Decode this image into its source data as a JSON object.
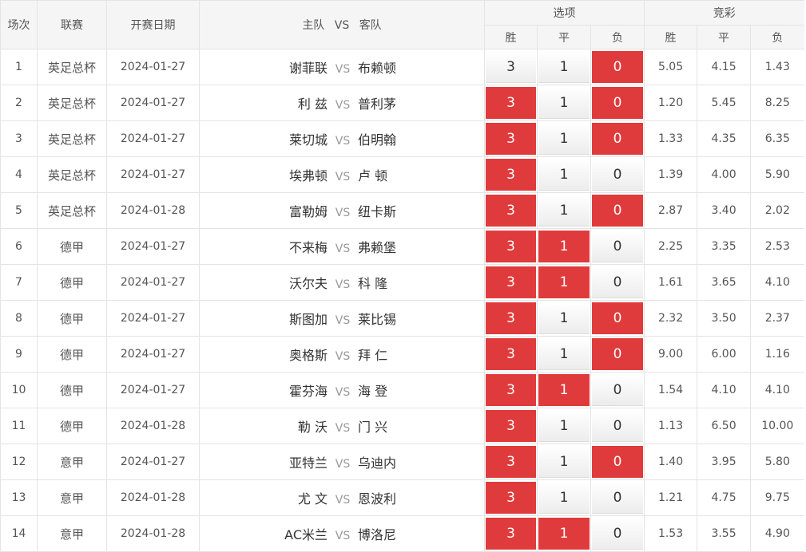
{
  "header": {
    "col_no": "场次",
    "col_league": "联赛",
    "col_date": "开赛日期",
    "col_home": "主队",
    "col_vs": "VS",
    "col_away": "客队",
    "group_options": "选项",
    "group_odds": "竞彩",
    "sub_win": "胜",
    "sub_draw": "平",
    "sub_lose": "负"
  },
  "colors": {
    "selected": "#e03b3c",
    "header_bg": "#f5f5f5",
    "border": "#e4e4e4"
  },
  "vs_text": "VS",
  "options": {
    "win": "3",
    "draw": "1",
    "lose": "0"
  },
  "rows": [
    {
      "no": "1",
      "league": "英足总杯",
      "date": "2024-01-27",
      "home": "谢菲联",
      "away": "布赖顿",
      "sel": [
        false,
        false,
        true
      ],
      "odds": [
        "5.05",
        "4.15",
        "1.43"
      ]
    },
    {
      "no": "2",
      "league": "英足总杯",
      "date": "2024-01-27",
      "home": "利 兹",
      "away": "普利茅",
      "sel": [
        true,
        false,
        true
      ],
      "odds": [
        "1.20",
        "5.45",
        "8.25"
      ]
    },
    {
      "no": "3",
      "league": "英足总杯",
      "date": "2024-01-27",
      "home": "莱切城",
      "away": "伯明翰",
      "sel": [
        true,
        false,
        true
      ],
      "odds": [
        "1.33",
        "4.35",
        "6.35"
      ]
    },
    {
      "no": "4",
      "league": "英足总杯",
      "date": "2024-01-27",
      "home": "埃弗顿",
      "away": "卢 顿",
      "sel": [
        true,
        false,
        false
      ],
      "odds": [
        "1.39",
        "4.00",
        "5.90"
      ]
    },
    {
      "no": "5",
      "league": "英足总杯",
      "date": "2024-01-28",
      "home": "富勒姆",
      "away": "纽卡斯",
      "sel": [
        true,
        false,
        true
      ],
      "odds": [
        "2.87",
        "3.40",
        "2.02"
      ]
    },
    {
      "no": "6",
      "league": "德甲",
      "date": "2024-01-27",
      "home": "不来梅",
      "away": "弗赖堡",
      "sel": [
        true,
        true,
        false
      ],
      "odds": [
        "2.25",
        "3.35",
        "2.53"
      ]
    },
    {
      "no": "7",
      "league": "德甲",
      "date": "2024-01-27",
      "home": "沃尔夫",
      "away": "科 隆",
      "sel": [
        true,
        true,
        false
      ],
      "odds": [
        "1.61",
        "3.65",
        "4.10"
      ]
    },
    {
      "no": "8",
      "league": "德甲",
      "date": "2024-01-27",
      "home": "斯图加",
      "away": "莱比锡",
      "sel": [
        true,
        false,
        true
      ],
      "odds": [
        "2.32",
        "3.50",
        "2.37"
      ]
    },
    {
      "no": "9",
      "league": "德甲",
      "date": "2024-01-27",
      "home": "奥格斯",
      "away": "拜 仁",
      "sel": [
        true,
        false,
        true
      ],
      "odds": [
        "9.00",
        "6.00",
        "1.16"
      ]
    },
    {
      "no": "10",
      "league": "德甲",
      "date": "2024-01-27",
      "home": "霍芬海",
      "away": "海 登",
      "sel": [
        true,
        true,
        false
      ],
      "odds": [
        "1.54",
        "4.10",
        "4.10"
      ]
    },
    {
      "no": "11",
      "league": "德甲",
      "date": "2024-01-28",
      "home": "勒 沃",
      "away": "门 兴",
      "sel": [
        true,
        false,
        false
      ],
      "odds": [
        "1.13",
        "6.50",
        "10.00"
      ]
    },
    {
      "no": "12",
      "league": "意甲",
      "date": "2024-01-27",
      "home": "亚特兰",
      "away": "乌迪内",
      "sel": [
        true,
        false,
        true
      ],
      "odds": [
        "1.40",
        "3.95",
        "5.80"
      ]
    },
    {
      "no": "13",
      "league": "意甲",
      "date": "2024-01-28",
      "home": "尤 文",
      "away": "恩波利",
      "sel": [
        true,
        false,
        false
      ],
      "odds": [
        "1.21",
        "4.75",
        "9.75"
      ]
    },
    {
      "no": "14",
      "league": "意甲",
      "date": "2024-01-28",
      "home": "AC米兰",
      "away": "博洛尼",
      "sel": [
        true,
        true,
        false
      ],
      "odds": [
        "1.53",
        "3.55",
        "4.90"
      ]
    }
  ]
}
